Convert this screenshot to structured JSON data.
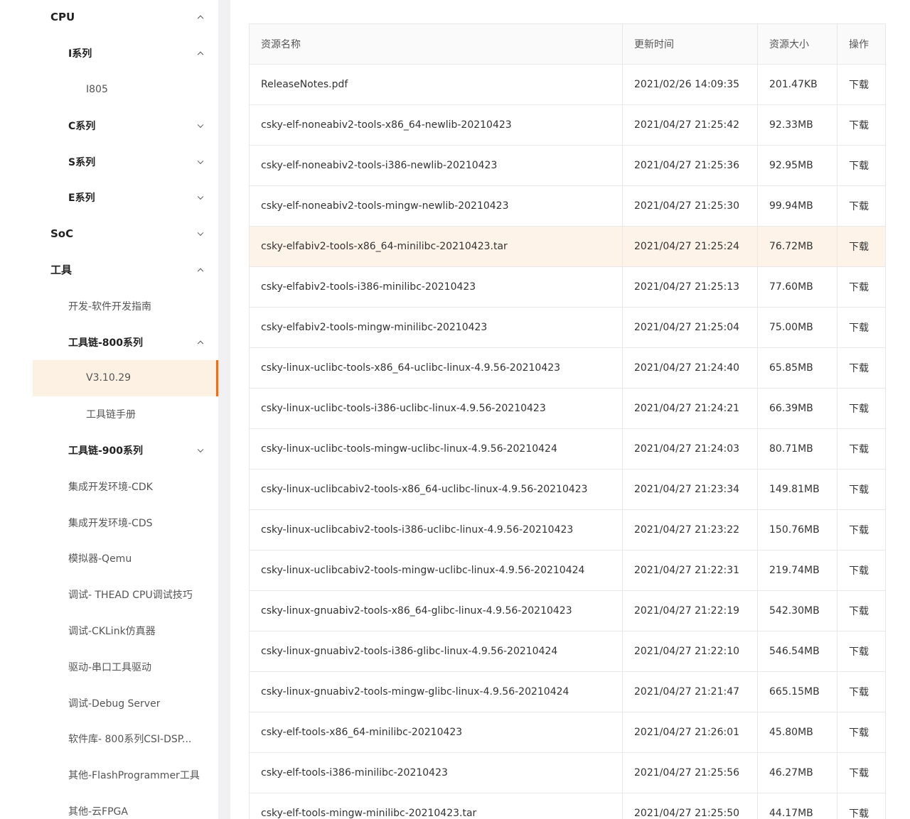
{
  "sidebar": {
    "items": [
      {
        "label": "CPU",
        "level": 0,
        "chevron": "up"
      },
      {
        "label": "I系列",
        "level": 1,
        "chevron": "up",
        "group": true
      },
      {
        "label": "I805",
        "level": 2
      },
      {
        "label": "C系列",
        "level": 1,
        "chevron": "down",
        "group": true
      },
      {
        "label": "S系列",
        "level": 1,
        "chevron": "down",
        "group": true
      },
      {
        "label": "E系列",
        "level": 1,
        "chevron": "down",
        "group": true
      },
      {
        "label": "SoC",
        "level": 0,
        "chevron": "down"
      },
      {
        "label": "工具",
        "level": 0,
        "chevron": "up"
      },
      {
        "label": "开发-软件开发指南",
        "level": 1
      },
      {
        "label": "工具链-800系列",
        "level": 1,
        "chevron": "up",
        "group": true
      },
      {
        "label": "V3.10.29",
        "level": 2,
        "active": true
      },
      {
        "label": "工具链手册",
        "level": 2
      },
      {
        "label": "工具链-900系列",
        "level": 1,
        "chevron": "down",
        "group": true
      },
      {
        "label": "集成开发环境-CDK",
        "level": 1
      },
      {
        "label": "集成开发环境-CDS",
        "level": 1
      },
      {
        "label": "模拟器-Qemu",
        "level": 1
      },
      {
        "label": "调试- THEAD CPU调试技巧",
        "level": 1
      },
      {
        "label": "调试-CKLink仿真器",
        "level": 1
      },
      {
        "label": "驱动-串口工具驱动",
        "level": 1
      },
      {
        "label": "调试-Debug Server",
        "level": 1
      },
      {
        "label": "软件库- 800系列CSI-DSP...",
        "level": 1
      },
      {
        "label": "其他-FlashProgrammer工具",
        "level": 1
      },
      {
        "label": "其他-云FPGA",
        "level": 1
      }
    ]
  },
  "table": {
    "headers": {
      "name": "资源名称",
      "time": "更新时间",
      "size": "资源大小",
      "action": "操作"
    },
    "download_label": "下载",
    "rows": [
      {
        "name": "ReleaseNotes.pdf",
        "time": "2021/02/26 14:09:35",
        "size": "201.47KB"
      },
      {
        "name": "csky-elf-noneabiv2-tools-x86_64-newlib-20210423",
        "time": "2021/04/27 21:25:42",
        "size": "92.33MB"
      },
      {
        "name": "csky-elf-noneabiv2-tools-i386-newlib-20210423",
        "time": "2021/04/27 21:25:36",
        "size": "92.95MB"
      },
      {
        "name": "csky-elf-noneabiv2-tools-mingw-newlib-20210423",
        "time": "2021/04/27 21:25:30",
        "size": "99.94MB"
      },
      {
        "name": "csky-elfabiv2-tools-x86_64-minilibc-20210423.tar",
        "time": "2021/04/27 21:25:24",
        "size": "76.72MB",
        "highlight": true
      },
      {
        "name": "csky-elfabiv2-tools-i386-minilibc-20210423",
        "time": "2021/04/27 21:25:13",
        "size": "77.60MB"
      },
      {
        "name": "csky-elfabiv2-tools-mingw-minilibc-20210423",
        "time": "2021/04/27 21:25:04",
        "size": "75.00MB"
      },
      {
        "name": "csky-linux-uclibc-tools-x86_64-uclibc-linux-4.9.56-20210423",
        "time": "2021/04/27 21:24:40",
        "size": "65.85MB"
      },
      {
        "name": "csky-linux-uclibc-tools-i386-uclibc-linux-4.9.56-20210423",
        "time": "2021/04/27 21:24:21",
        "size": "66.39MB"
      },
      {
        "name": "csky-linux-uclibc-tools-mingw-uclibc-linux-4.9.56-20210424",
        "time": "2021/04/27 21:24:03",
        "size": "80.71MB"
      },
      {
        "name": "csky-linux-uclibcabiv2-tools-x86_64-uclibc-linux-4.9.56-20210423",
        "time": "2021/04/27 21:23:34",
        "size": "149.81MB"
      },
      {
        "name": "csky-linux-uclibcabiv2-tools-i386-uclibc-linux-4.9.56-20210423",
        "time": "2021/04/27 21:23:22",
        "size": "150.76MB"
      },
      {
        "name": "csky-linux-uclibcabiv2-tools-mingw-uclibc-linux-4.9.56-20210424",
        "time": "2021/04/27 21:22:31",
        "size": "219.74MB"
      },
      {
        "name": "csky-linux-gnuabiv2-tools-x86_64-glibc-linux-4.9.56-20210423",
        "time": "2021/04/27 21:22:19",
        "size": "542.30MB"
      },
      {
        "name": "csky-linux-gnuabiv2-tools-i386-glibc-linux-4.9.56-20210424",
        "time": "2021/04/27 21:22:10",
        "size": "546.54MB"
      },
      {
        "name": "csky-linux-gnuabiv2-tools-mingw-glibc-linux-4.9.56-20210424",
        "time": "2021/04/27 21:21:47",
        "size": "665.15MB"
      },
      {
        "name": "csky-elf-tools-x86_64-minilibc-20210423",
        "time": "2021/04/27 21:26:01",
        "size": "45.80MB"
      },
      {
        "name": "csky-elf-tools-i386-minilibc-20210423",
        "time": "2021/04/27 21:25:56",
        "size": "46.27MB"
      },
      {
        "name": "csky-elf-tools-mingw-minilibc-20210423.tar",
        "time": "2021/04/27 21:25:50",
        "size": "44.17MB"
      }
    ]
  }
}
